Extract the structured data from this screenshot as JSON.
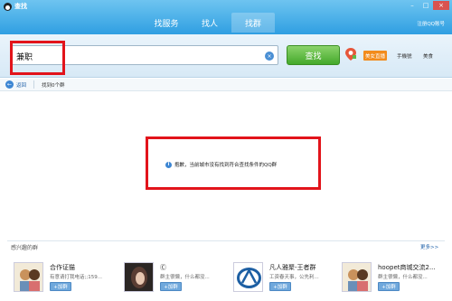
{
  "app": {
    "title": "查找"
  },
  "tabs": [
    {
      "label": "找服务"
    },
    {
      "label": "找人"
    },
    {
      "label": "找群"
    }
  ],
  "register_link": "注册QQ账号",
  "search": {
    "value": "兼职",
    "button_label": "查找"
  },
  "ads": {
    "badge": "美女直播",
    "links": [
      "手機號",
      "美食"
    ]
  },
  "nav": {
    "back_label": "返回",
    "breadcrumb": "找到0个群"
  },
  "message": {
    "icon": "i",
    "text": "抱歉，当前城市没有找到符合查找条件的QQ群"
  },
  "interest": {
    "title": "感兴趣的群",
    "more": "更多>>",
    "join_label": "+加群",
    "groups": [
      {
        "name": "合作证猫",
        "desc": "有意请打我电话;;159..."
      },
      {
        "name": "Ⓒ",
        "desc": "群主很懒，什么都没..."
      },
      {
        "name": "凡人雅聚-王者群",
        "desc": "工资春天事，公先利..."
      },
      {
        "name": "hoopet商城交流2...",
        "desc": "群主很懒，什么都没..."
      }
    ]
  },
  "colors": {
    "accent": "#2f9fe2",
    "highlight": "#e2141b",
    "button": "#44a92b"
  }
}
